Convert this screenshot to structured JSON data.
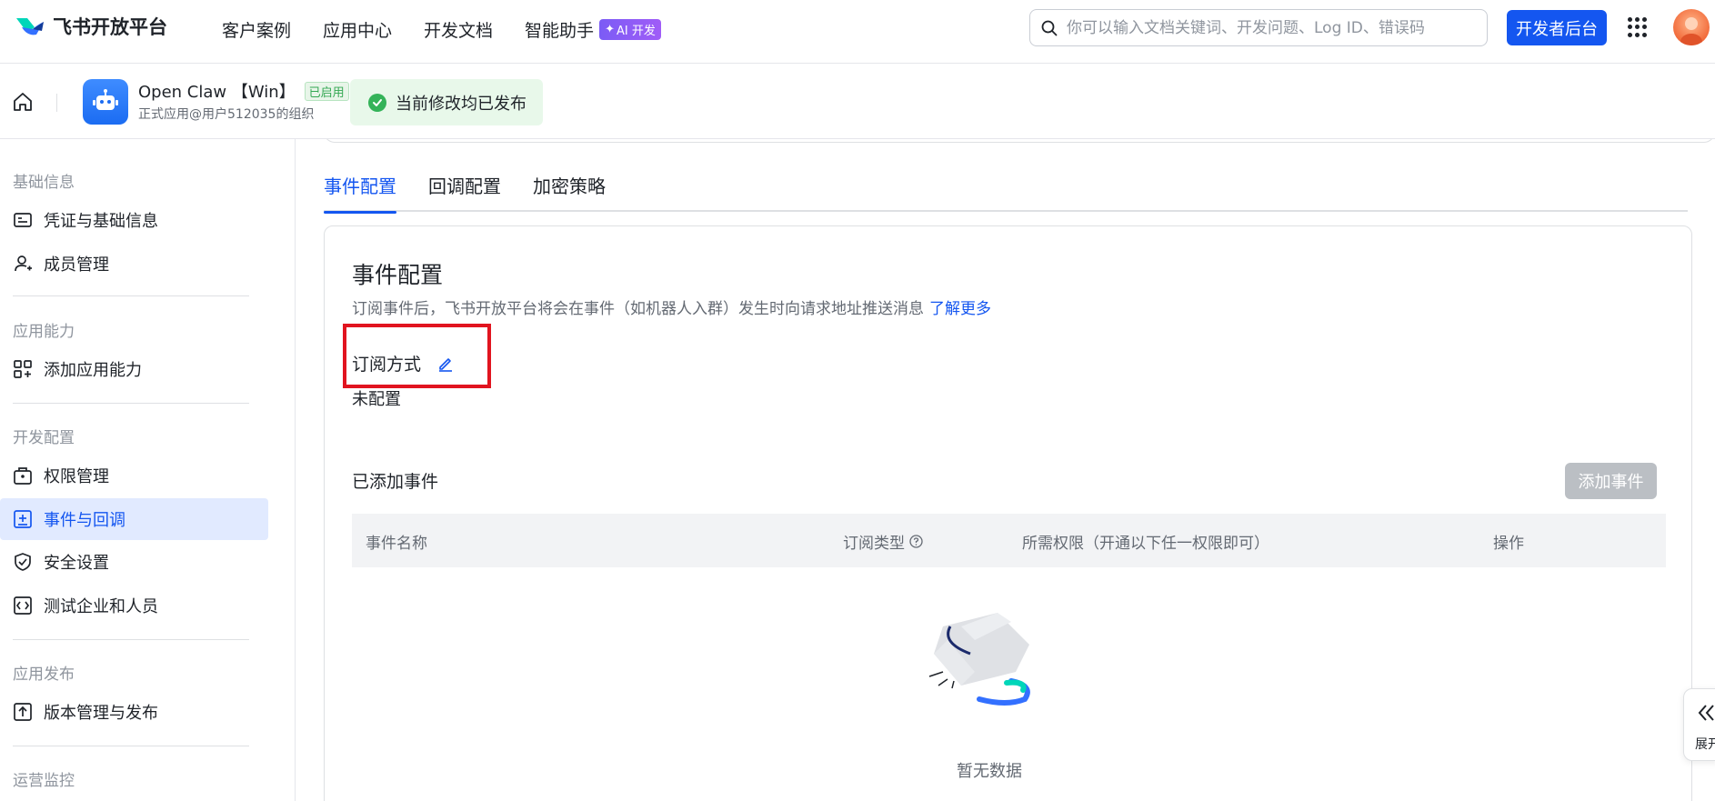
{
  "header": {
    "logo_text": "飞书开放平台",
    "nav": [
      {
        "label": "客户案例"
      },
      {
        "label": "应用中心"
      },
      {
        "label": "开发文档"
      },
      {
        "label": "智能助手",
        "badge": "AI 开发"
      }
    ],
    "search_placeholder": "你可以输入文档关键词、开发问题、Log ID、错误码",
    "dev_console_label": "开发者后台"
  },
  "app": {
    "name": "Open Claw 【Win】",
    "status": "已启用",
    "subtitle": "正式应用@用户512035的组织",
    "publish_status": "当前修改均已发布"
  },
  "sidebar": {
    "groups": [
      {
        "label": "基础信息",
        "items": [
          {
            "label": "凭证与基础信息",
            "icon": "credential-icon"
          },
          {
            "label": "成员管理",
            "icon": "member-icon"
          }
        ]
      },
      {
        "label": "应用能力",
        "items": [
          {
            "label": "添加应用能力",
            "icon": "app-ability-icon"
          }
        ]
      },
      {
        "label": "开发配置",
        "items": [
          {
            "label": "权限管理",
            "icon": "permission-icon"
          },
          {
            "label": "事件与回调",
            "icon": "event-icon",
            "active": true
          },
          {
            "label": "安全设置",
            "icon": "shield-icon"
          },
          {
            "label": "测试企业和人员",
            "icon": "test-icon"
          }
        ]
      },
      {
        "label": "应用发布",
        "items": [
          {
            "label": "版本管理与发布",
            "icon": "upload-icon"
          }
        ]
      },
      {
        "label": "运营监控",
        "items": []
      }
    ]
  },
  "main": {
    "tabs": [
      {
        "label": "事件配置",
        "active": true
      },
      {
        "label": "回调配置"
      },
      {
        "label": "加密策略"
      }
    ],
    "card": {
      "title": "事件配置",
      "description": "订阅事件后，飞书开放平台将会在事件（如机器人入群）发生时向请求地址推送消息",
      "learn_more": "了解更多",
      "subscribe_label": "订阅方式",
      "subscribe_value": "未配置",
      "added_events_label": "已添加事件",
      "add_event_button": "添加事件",
      "table_columns": [
        "事件名称",
        "订阅类型",
        "所需权限（开通以下任一权限即可）",
        "操作"
      ],
      "empty_text": "暂无数据"
    }
  },
  "side_toggle_label": "展开",
  "colors": {
    "accent": "#1456f0",
    "highlight": "#e1141f",
    "success": "#34b359"
  }
}
